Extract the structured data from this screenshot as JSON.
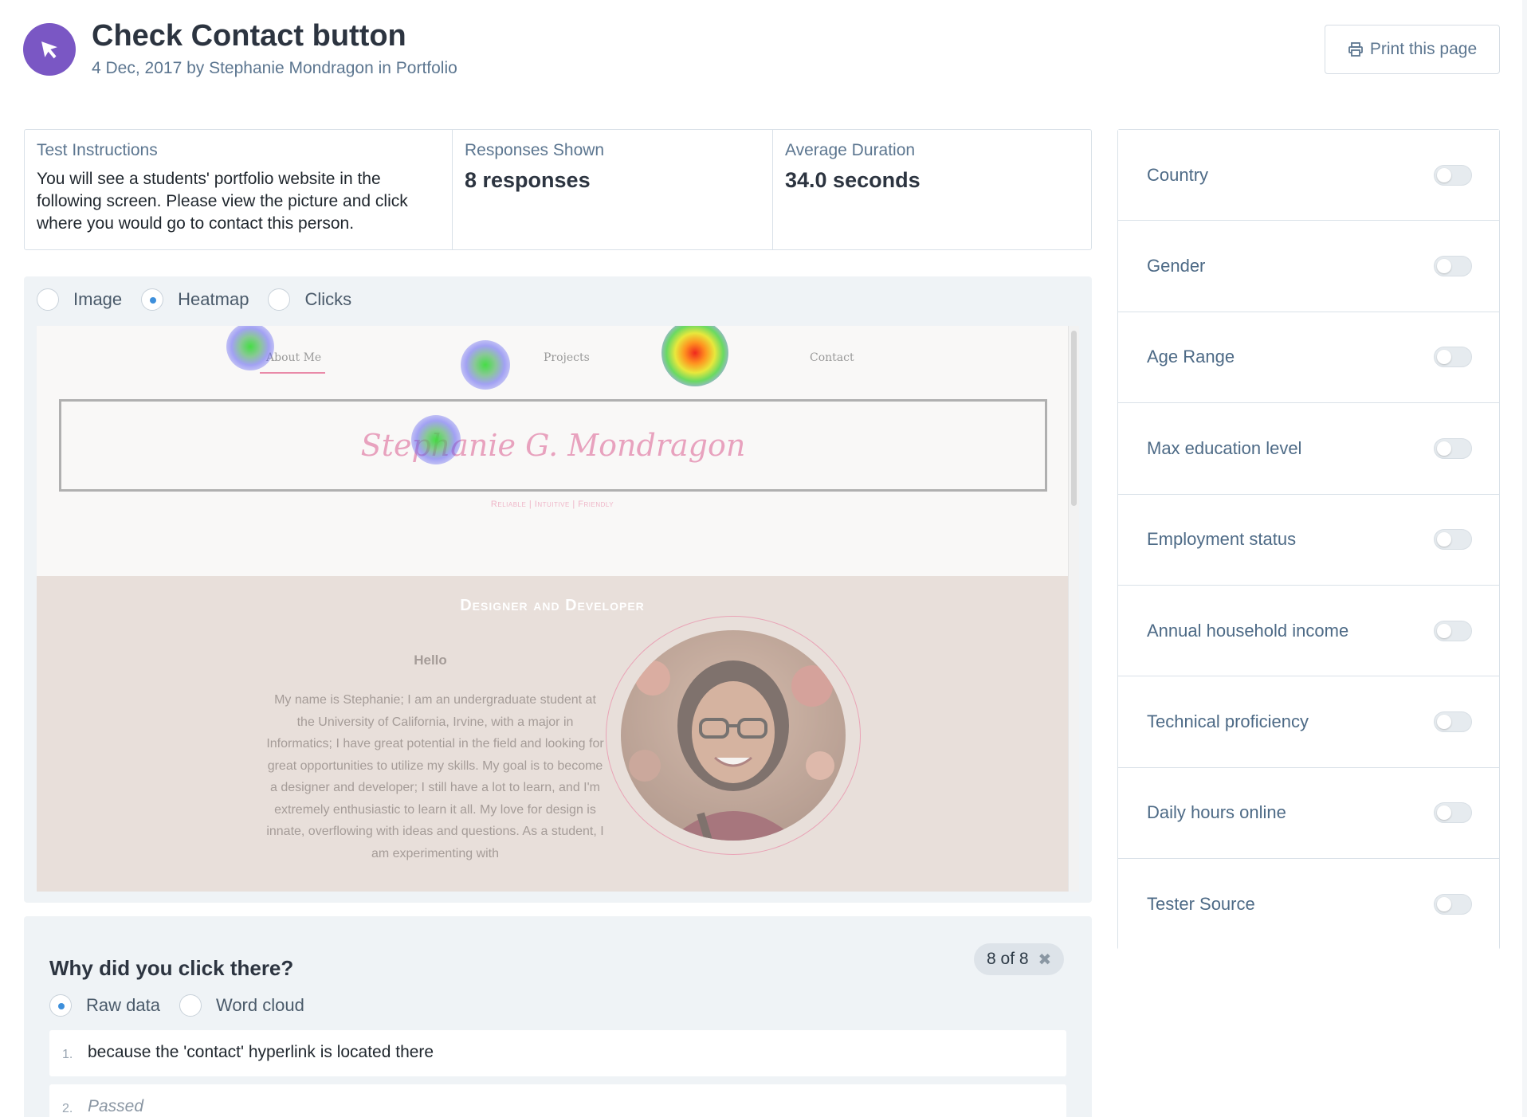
{
  "header": {
    "title": "Check Contact button",
    "subtitle": "4 Dec, 2017 by Stephanie Mondragon in Portfolio",
    "print_label": "Print this page"
  },
  "stats": {
    "instructions_label": "Test Instructions",
    "instructions_text": "You will see a students' portfolio website in the following screen. Please view the picture and click where you would go to contact this person.",
    "responses_label": "Responses Shown",
    "responses_value": "8 responses",
    "duration_label": "Average Duration",
    "duration_value": "34.0 seconds"
  },
  "view_mode": {
    "options": [
      "Image",
      "Heatmap",
      "Clicks"
    ],
    "selected": "Heatmap"
  },
  "preview": {
    "nav": [
      "About Me",
      "Projects",
      "Contact"
    ],
    "site_name": "Stephanie G. Mondragon",
    "tagline": "Reliable | Intuitive | Friendly",
    "section_title": "Designer and Developer",
    "hello": "Hello",
    "bio": "My name is Stephanie; I am an undergraduate student at the University of California, Irvine, with a major in Informatics; I have great potential in the field and looking for great opportunities to utilize my skills. My goal is to become a designer and developer; I still have a lot to learn, and I'm extremely enthusiastic to learn it all. My love for design is innate, overflowing with ideas and questions. As a student, I am experimenting with"
  },
  "question": {
    "title": "Why did you click there?",
    "count_badge": "8 of 8",
    "modes": [
      "Raw data",
      "Word cloud"
    ],
    "selected_mode": "Raw data",
    "answers": [
      {
        "num": "1.",
        "text": "because the 'contact' hyperlink is located there"
      },
      {
        "num": "2.",
        "text": "Passed"
      }
    ]
  },
  "filters": [
    "Country",
    "Gender",
    "Age Range",
    "Max education level",
    "Employment status",
    "Annual household income",
    "Technical proficiency",
    "Daily hours online",
    "Tester Source"
  ],
  "colors": {
    "brand": "#7a57c4",
    "accent": "#3d8fdb",
    "label": "#4d6a86"
  }
}
